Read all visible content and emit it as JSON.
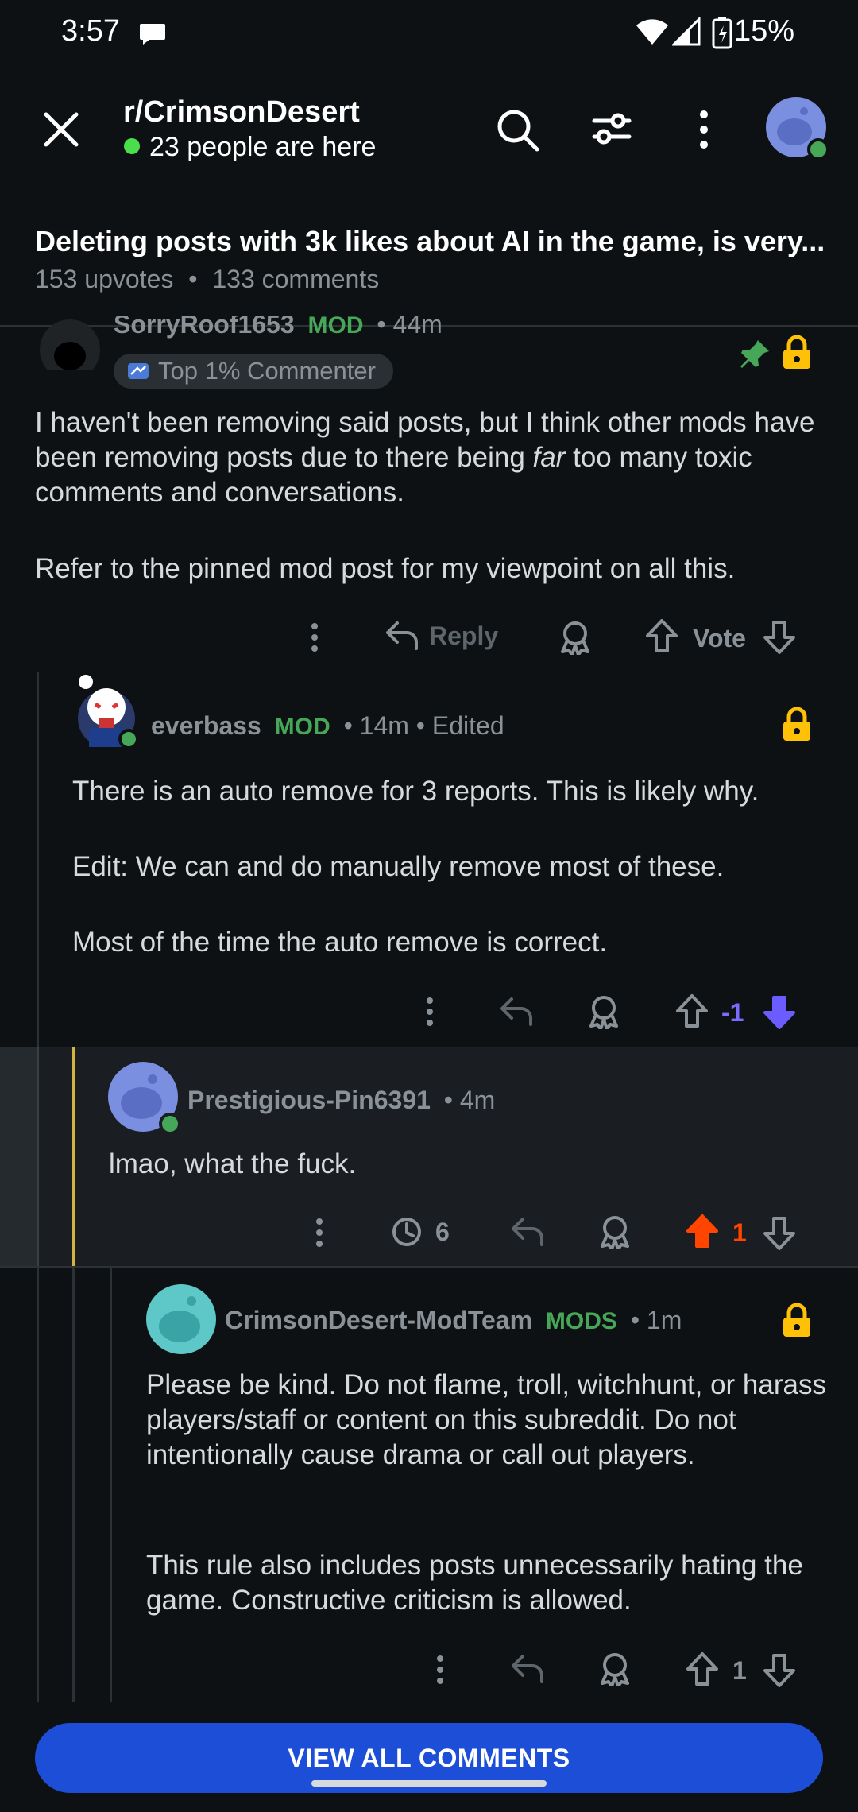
{
  "status_bar": {
    "time": "3:57",
    "battery": "15%"
  },
  "header": {
    "subreddit": "r/CrimsonDesert",
    "online": "23 people are here"
  },
  "post": {
    "title": "Deleting posts with 3k likes about AI in the game, is very...",
    "upvotes": "153 upvotes",
    "comments": "133 comments",
    "separator": "•"
  },
  "comments": [
    {
      "username": "SorryRoof1653",
      "badge": "MOD",
      "time": "• 44m",
      "flair": "Top 1% Commenter",
      "body_part1": "I haven't been removing said posts, but I think other mods have been removing posts due to there being ",
      "body_emph": "far",
      "body_part2": " too many toxic comments and conversations.",
      "body_para2": "Refer to the pinned mod post for my viewpoint on all this.",
      "reply_label": "Reply",
      "vote_label": "Vote"
    },
    {
      "username": "everbass",
      "badge": "MOD",
      "time": "• 14m • Edited",
      "para1": "There is an auto remove for 3 reports. This is likely why.",
      "para2": "Edit: We can and do manually remove most of these.",
      "para3": "Most of the time the auto remove is correct.",
      "score": "-1"
    },
    {
      "username": "Prestigious-Pin6391",
      "time": "• 4m",
      "body": "lmao, what the fuck.",
      "history_count": "6",
      "score": "1"
    },
    {
      "username": "CrimsonDesert-ModTeam",
      "badge": "MODS",
      "time": "• 1m",
      "para1": "Please be kind. Do not flame, troll, witchhunt, or harass players/staff or content on this subreddit. Do not intentionally cause drama or call out players.",
      "para2": "This rule also includes posts unnecessarily hating the game. Constructive criticism is allowed.",
      "score": "1"
    }
  ],
  "footer": {
    "view_all": "VIEW ALL COMMENTS"
  },
  "colors": {
    "background": "#0e1113",
    "mod_green": "#46a758",
    "upvote_orange": "#ff4500",
    "downvote_purple": "#6a5cff",
    "lock_yellow": "#ffc107",
    "button_blue": "#1d4ed8"
  }
}
